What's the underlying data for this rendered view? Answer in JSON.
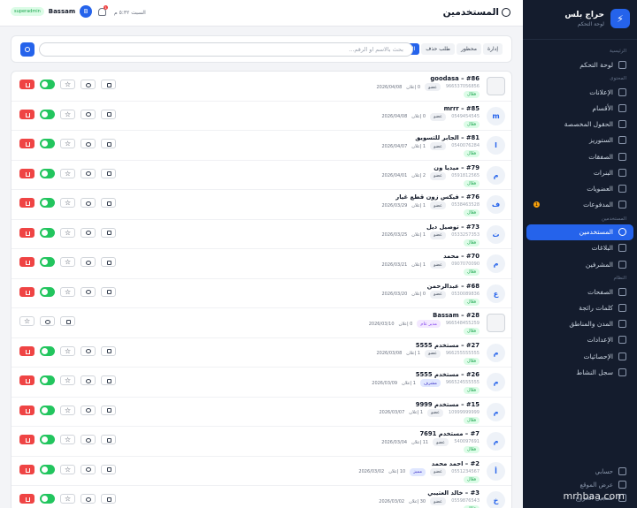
{
  "sidebar": {
    "brand_name": "حراج بلس",
    "brand_sub": "لوحة التحكم",
    "sections": [
      {
        "title": "الرئيسية",
        "items": [
          {
            "label": "لوحة التحكم",
            "icon": "home-icon"
          }
        ]
      },
      {
        "title": "المحتوى",
        "items": [
          {
            "label": "الإعلانات",
            "icon": "ads-icon"
          },
          {
            "label": "الأقسام",
            "icon": "grid-icon"
          },
          {
            "label": "الحقول المخصصة",
            "icon": "fields-icon"
          },
          {
            "label": "الستوريز",
            "icon": "stories-icon"
          },
          {
            "label": "الصفقات",
            "icon": "tag-icon"
          },
          {
            "label": "البنرات",
            "icon": "image-icon"
          },
          {
            "label": "العضويات",
            "icon": "star-icon"
          },
          {
            "label": "المدفوعات",
            "icon": "card-icon",
            "badge": "1"
          }
        ]
      },
      {
        "title": "المستخدمين",
        "items": [
          {
            "label": "المستخدمين",
            "icon": "users-icon",
            "active": true
          },
          {
            "label": "البلاغات",
            "icon": "flag-icon"
          },
          {
            "label": "المشرفين",
            "icon": "shield-icon"
          }
        ]
      },
      {
        "title": "النظام",
        "items": [
          {
            "label": "الصفحات",
            "icon": "page-icon"
          },
          {
            "label": "كلمات رائجة",
            "icon": "trend-icon"
          },
          {
            "label": "المدن والمناطق",
            "icon": "globe-icon"
          },
          {
            "label": "الإعدادات",
            "icon": "gear-icon"
          },
          {
            "label": "الإحصائيات",
            "icon": "chart-icon"
          },
          {
            "label": "سجل النشاط",
            "icon": "activity-icon"
          }
        ]
      }
    ],
    "bottom": [
      "حسابي",
      "عرض الموقع",
      "تسجيل الخروج"
    ]
  },
  "header": {
    "title": "المستخدمين",
    "datetime": "السبت ٥:٣٢ م",
    "notifications": "1",
    "user_initial": "B",
    "user_name": "Bassam",
    "user_role": "superadmin"
  },
  "filters": {
    "tabs": [
      {
        "label": "الكل",
        "active": true
      },
      {
        "label": "طلب حذف"
      },
      {
        "label": "محظور"
      },
      {
        "label": "إدارة"
      }
    ],
    "search_placeholder": "بحث بالاسم او الرقم..."
  },
  "users": [
    {
      "name": "#86 – goodasa",
      "phone": "966537056856",
      "status": "فعّال",
      "role": "عضو",
      "ads": "0 إعلان",
      "date": "2026/04/08",
      "avatar": "",
      "img": true,
      "toggle": true,
      "delete": true
    },
    {
      "name": "#85 – mrrr",
      "phone": "0549454545",
      "status": "فعّال",
      "role": "عضو",
      "ads": "0 إعلان",
      "date": "2026/04/08",
      "avatar": "m",
      "toggle": true,
      "delete": true
    },
    {
      "name": "#81 – الجابر للتسويق",
      "phone": "0540076284",
      "status": "فعّال",
      "role": "عضو",
      "ads": "1 إعلان",
      "date": "2026/04/07",
      "avatar": "ا",
      "toggle": true,
      "delete": true
    },
    {
      "name": "#79 – ميديا ون",
      "phone": "0591812565",
      "status": "فعّال",
      "role": "عضو",
      "ads": "2 إعلان",
      "date": "2026/04/01",
      "avatar": "م",
      "toggle": true,
      "delete": true
    },
    {
      "name": "#76 – فيكس زون قطع غيار",
      "phone": "0538463528",
      "status": "فعّال",
      "role": "عضو",
      "ads": "1 إعلان",
      "date": "2026/03/29",
      "avatar": "ف",
      "toggle": true,
      "delete": true
    },
    {
      "name": "#73 – توصيل ديل",
      "phone": "0533257353",
      "status": "فعّال",
      "role": "عضو",
      "ads": "1 إعلان",
      "date": "2026/03/25",
      "avatar": "ت",
      "toggle": true,
      "delete": true
    },
    {
      "name": "#70 – محمد",
      "phone": "0907070090",
      "status": "فعّال",
      "role": "عضو",
      "ads": "1 إعلان",
      "date": "2026/03/21",
      "avatar": "م",
      "toggle": true,
      "delete": true
    },
    {
      "name": "#68 – عبدالرحمن",
      "phone": "0530089836",
      "status": "فعّال",
      "role": "عضو",
      "ads": "0 إعلان",
      "date": "2026/03/20",
      "avatar": "ع",
      "toggle": true,
      "delete": true
    },
    {
      "name": "#28 – Bassam",
      "phone": "966548455259",
      "status": "فعّال",
      "role": "مدير عام",
      "role_class": "sup",
      "ads": "0 إعلان",
      "date": "2026/03/10",
      "avatar": "",
      "img": true,
      "toggle": false,
      "delete": false
    },
    {
      "name": "#27 – مستخدم 5555",
      "phone": "966255555555",
      "status": "فعّال",
      "role": "عضو",
      "ads": "1 إعلان",
      "date": "2026/03/08",
      "avatar": "م",
      "toggle": true,
      "delete": true
    },
    {
      "name": "#26 – مستخدم 5555",
      "phone": "966524555555",
      "status": "فعّال",
      "role": "مشرف",
      "role_class": "mod",
      "ads": "1 إعلان",
      "date": "2026/03/09",
      "avatar": "م",
      "toggle": true,
      "delete": true
    },
    {
      "name": "#15 – مستخدم 9999",
      "phone": "10999999999",
      "status": "فعّال",
      "role": "عضو",
      "ads": "1 إعلان",
      "date": "2026/03/07",
      "avatar": "م",
      "toggle": true,
      "delete": true
    },
    {
      "name": "#7 – مستخدم 7691",
      "phone": "540097691",
      "status": "فعّال",
      "role": "عضو",
      "ads": "11 إعلان",
      "date": "2026/03/04",
      "avatar": "م",
      "toggle": true,
      "delete": true
    },
    {
      "name": "#2 – احمد محمد",
      "phone": "0551234567",
      "status": "فعّال",
      "role": "عضو",
      "role2": "مميز",
      "ads": "10 إعلان",
      "date": "2026/03/02",
      "avatar": "أ",
      "toggle": true,
      "delete": true
    },
    {
      "name": "#3 – خالد العتيبي",
      "phone": "0559876543",
      "status": "فعّال",
      "role": "عضو",
      "ads": "30 إعلان",
      "date": "2026/03/02",
      "avatar": "خ",
      "toggle": true,
      "delete": true
    }
  ],
  "watermark": "mrhbaa.com",
  "colors": {
    "accent": "#2563eb",
    "sidebar": "#141c2d",
    "success": "#22c55e",
    "danger": "#ef4444"
  }
}
